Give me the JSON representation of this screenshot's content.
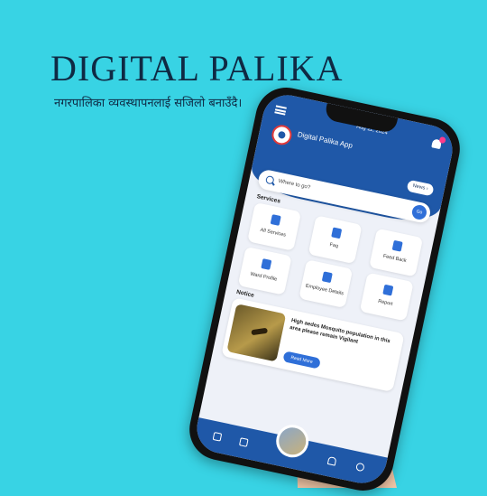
{
  "headline": "DIGITAL PALIKA",
  "tagline": "नगरपालिका व्यवस्थापनलाई सजिलो बनाउँदै।",
  "app": {
    "date": "Aug 11, 2024",
    "title": "Digital Palika App",
    "news_label": "News",
    "search_placeholder": "Where to go?",
    "go_label": "Go",
    "services_label": "Services",
    "notice_label": "Notice",
    "services": [
      {
        "label": "All Services"
      },
      {
        "label": "Faq"
      },
      {
        "label": "Feed Back"
      },
      {
        "label": "Ward Profile"
      },
      {
        "label": "Employee Details"
      },
      {
        "label": "Report"
      }
    ],
    "notice": {
      "text": "High aedes Mosquito population in this area please remain Vigilant",
      "button": "Read More"
    }
  }
}
